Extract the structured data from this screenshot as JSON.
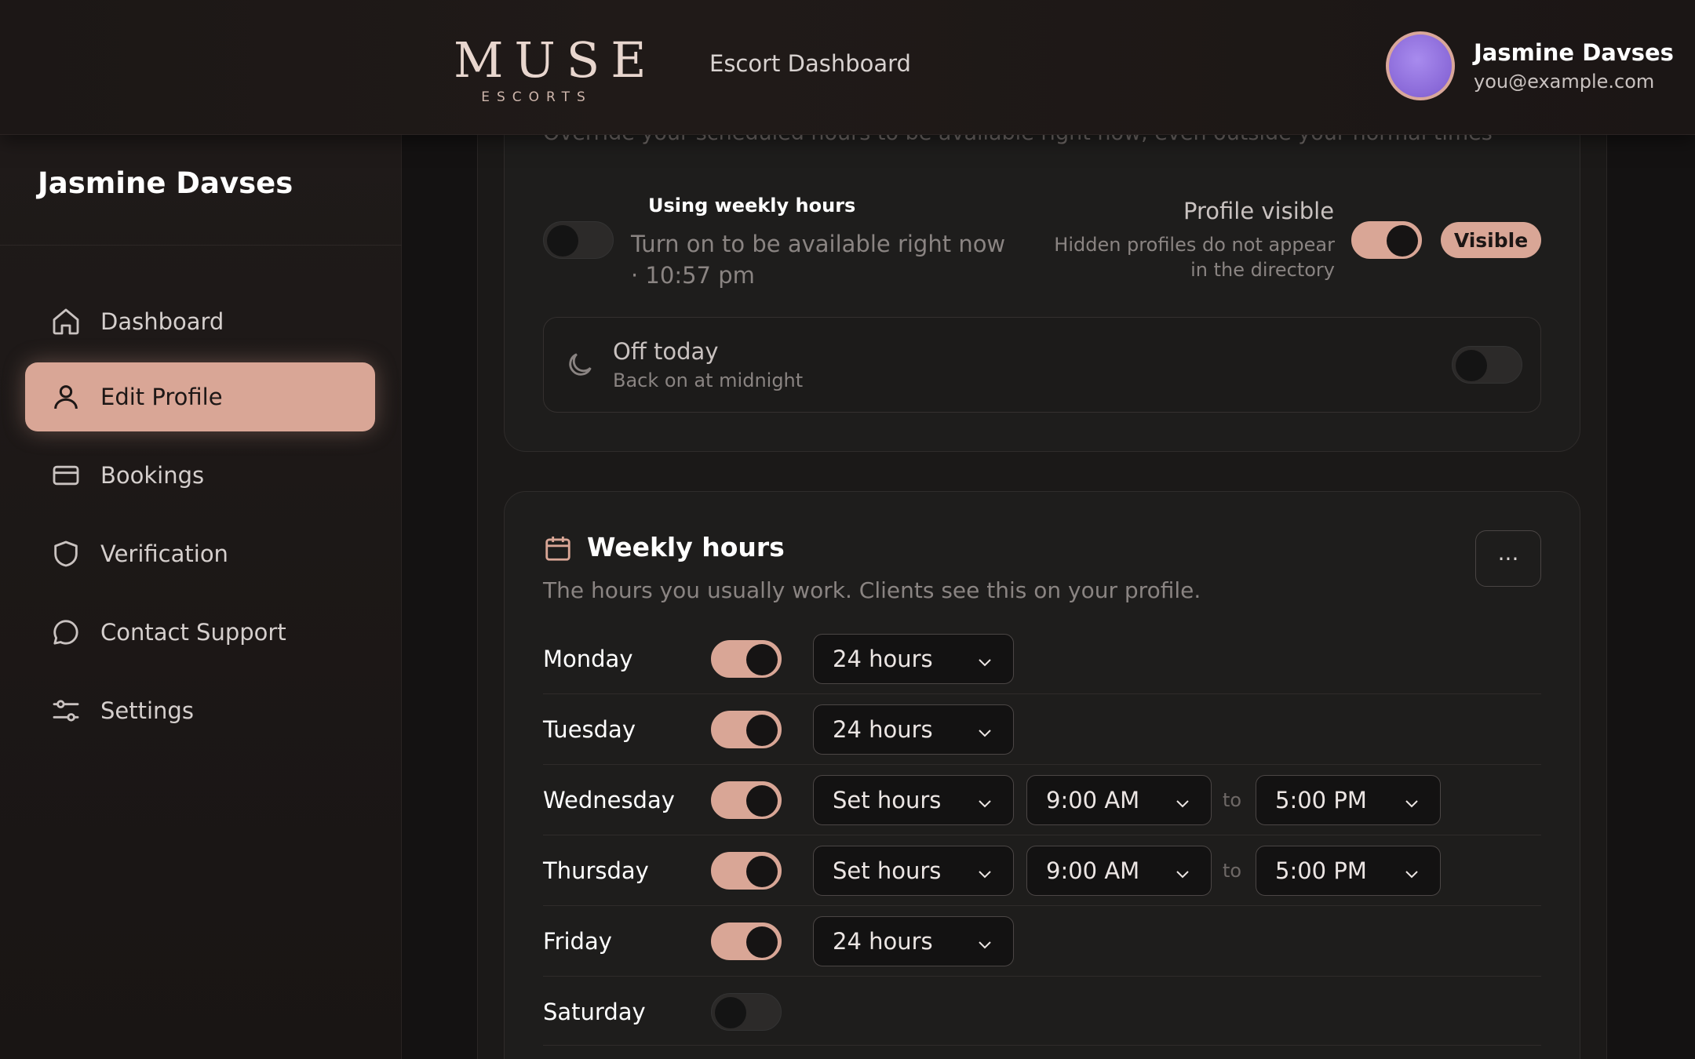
{
  "header": {
    "logo_main": "MUSE",
    "logo_sub": "ESCORTS",
    "title": "Escort Dashboard",
    "user_name": "Jasmine Davses",
    "user_email": "you@example.com"
  },
  "sidebar": {
    "user_name": "Jasmine Davses",
    "items": [
      {
        "label": "Dashboard",
        "icon": "home-icon"
      },
      {
        "label": "Edit Profile",
        "icon": "user-icon",
        "active": true
      },
      {
        "label": "Bookings",
        "icon": "credit-card-icon"
      },
      {
        "label": "Verification",
        "icon": "shield-icon"
      },
      {
        "label": "Contact Support",
        "icon": "chat-bubble-icon"
      },
      {
        "label": "Settings",
        "icon": "sliders-icon"
      }
    ]
  },
  "availability": {
    "override_text": "Override your scheduled hours to be available right now, even outside your normal times",
    "weekly_label": "Using weekly hours",
    "available_now_line1": "Turn on to be available right now",
    "available_now_line2": "· 10:57 pm",
    "profile_visible_label": "Profile visible",
    "profile_visible_desc1": "Hidden profiles do not appear",
    "profile_visible_desc2": "in the directory",
    "visible_badge": "Visible",
    "off_today_title": "Off today",
    "off_today_desc": "Back on at midnight"
  },
  "weekly": {
    "title": "Weekly hours",
    "subtitle": "The hours you usually work. Clients see this on your profile.",
    "more_label": "···",
    "to_label": "to",
    "days": [
      {
        "name": "Monday",
        "enabled": true,
        "mode": "24 hours"
      },
      {
        "name": "Tuesday",
        "enabled": true,
        "mode": "24 hours"
      },
      {
        "name": "Wednesday",
        "enabled": true,
        "mode": "Set hours",
        "start": "9:00 AM",
        "end": "5:00 PM"
      },
      {
        "name": "Thursday",
        "enabled": true,
        "mode": "Set hours",
        "start": "9:00 AM",
        "end": "5:00 PM"
      },
      {
        "name": "Friday",
        "enabled": true,
        "mode": "24 hours"
      },
      {
        "name": "Saturday",
        "enabled": false
      }
    ]
  },
  "colors": {
    "accent": "#d9a696",
    "background": "#141212",
    "card": "#1e1d1c"
  }
}
